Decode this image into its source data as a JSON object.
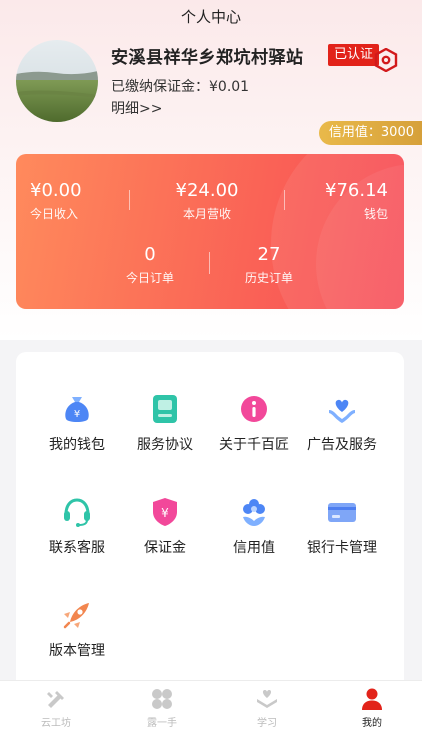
{
  "header": {
    "title": "个人中心"
  },
  "profile": {
    "station_name": "安溪县祥华乡郑坑村驿站",
    "verified_label": "已认证",
    "deposit": "已缴纳保证金：¥0.01",
    "detail_link": "明细>>",
    "credit": "信用值：3000"
  },
  "stats": {
    "today_income": {
      "value": "¥0.00",
      "label": "今日收入"
    },
    "month_revenue": {
      "value": "¥24.00",
      "label": "本月营收"
    },
    "wallet": {
      "value": "¥76.14",
      "label": "钱包"
    },
    "today_orders": {
      "value": "0",
      "label": "今日订单"
    },
    "history_orders": {
      "value": "27",
      "label": "历史订单"
    }
  },
  "menu": {
    "items": [
      {
        "label": "我的钱包",
        "icon": "money-bag-icon"
      },
      {
        "label": "服务协议",
        "icon": "document-icon"
      },
      {
        "label": "关于千百匠",
        "icon": "info-icon"
      },
      {
        "label": "广告及服务",
        "icon": "heart-hand-icon"
      },
      {
        "label": "联系客服",
        "icon": "headset-icon"
      },
      {
        "label": "保证金",
        "icon": "shield-yen-icon"
      },
      {
        "label": "信用值",
        "icon": "flower-icon"
      },
      {
        "label": "银行卡管理",
        "icon": "bank-card-icon"
      },
      {
        "label": "版本管理",
        "icon": "rocket-icon"
      }
    ]
  },
  "tabbar": {
    "tabs": [
      {
        "label": "云工坊",
        "icon": "tools-icon",
        "active": false
      },
      {
        "label": "露一手",
        "icon": "grid-icon",
        "active": false
      },
      {
        "label": "学习",
        "icon": "learn-icon",
        "active": false
      },
      {
        "label": "我的",
        "icon": "user-icon",
        "active": true
      }
    ]
  },
  "colors": {
    "accent_red": "#e2231a",
    "card_gradient_start": "#ff8a5c",
    "card_gradient_end": "#f74a55",
    "credit_gold": "#e0ad42"
  }
}
